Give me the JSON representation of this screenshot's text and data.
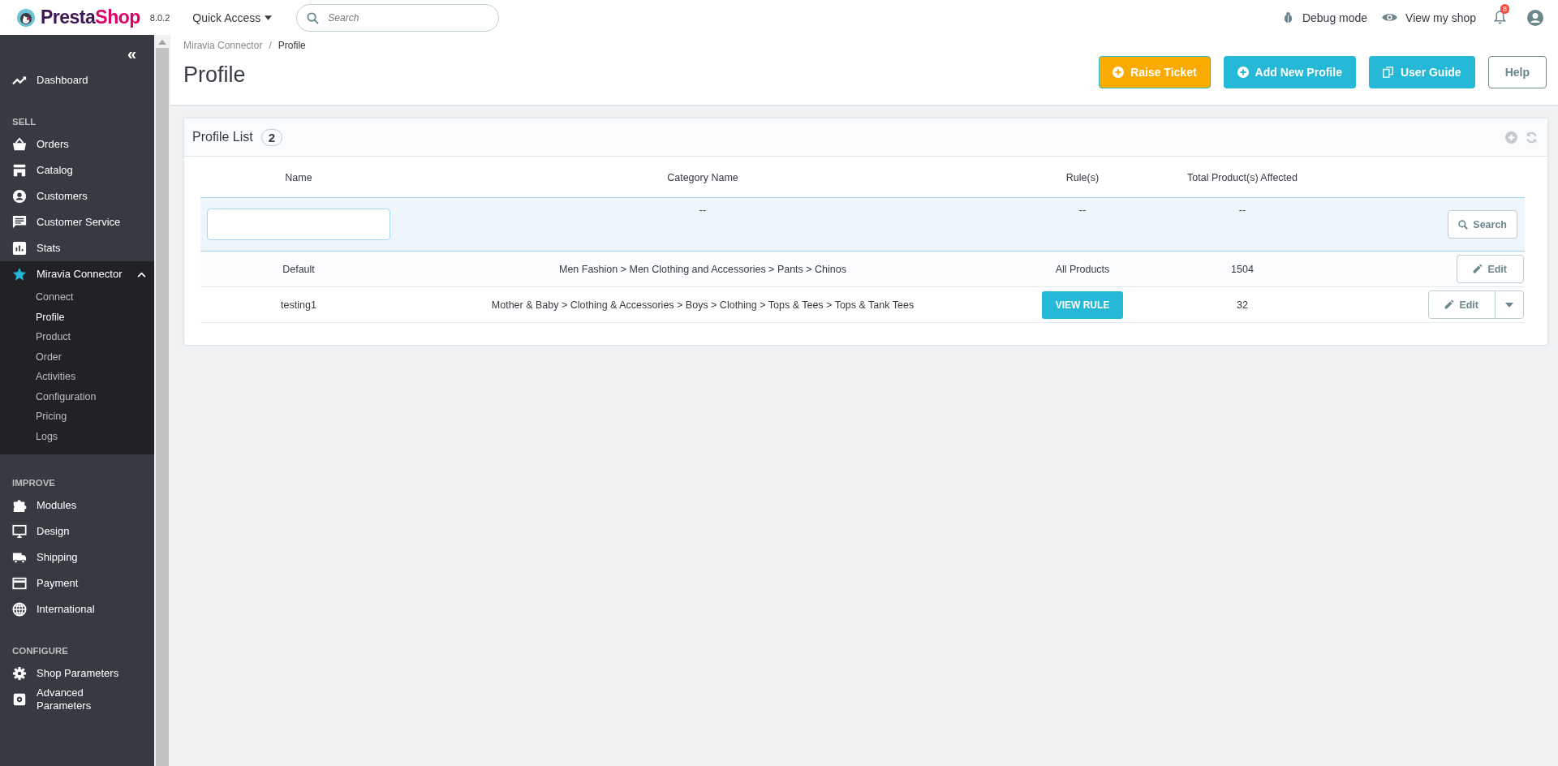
{
  "top_bar": {
    "brand": {
      "name_start": "Presta",
      "name_end": "Shop",
      "version": "8.0.2"
    },
    "quick_access": "Quick Access",
    "search": {
      "placeholder": "Search"
    },
    "debug_mode": "Debug mode",
    "view_shop": "View my shop",
    "notification_count": "8"
  },
  "sidebar": {
    "collapse": "«",
    "sections": [
      {
        "items": [
          {
            "label": "Dashboard",
            "expanded": false
          }
        ]
      },
      {
        "heading": "SELL",
        "items": [
          {
            "label": "Orders",
            "expanded": false
          },
          {
            "label": "Catalog",
            "expanded": false
          },
          {
            "label": "Customers",
            "expanded": false
          },
          {
            "label": "Customer Service",
            "expanded": false
          },
          {
            "label": "Stats",
            "expanded": false
          },
          {
            "label": "Miravia Connector",
            "expanded": true,
            "children": [
              {
                "label": "Connect",
                "selected": false
              },
              {
                "label": "Profile",
                "selected": true
              },
              {
                "label": "Product",
                "selected": false
              },
              {
                "label": "Order",
                "selected": false
              },
              {
                "label": "Activities",
                "selected": false
              },
              {
                "label": "Configuration",
                "selected": false
              },
              {
                "label": "Pricing",
                "selected": false
              },
              {
                "label": "Logs",
                "selected": false
              }
            ]
          }
        ]
      },
      {
        "heading": "IMPROVE",
        "items": [
          {
            "label": "Modules",
            "expanded": false
          },
          {
            "label": "Design",
            "expanded": false
          },
          {
            "label": "Shipping",
            "expanded": false
          },
          {
            "label": "Payment",
            "expanded": false
          },
          {
            "label": "International",
            "expanded": false
          }
        ]
      },
      {
        "heading": "CONFIGURE",
        "items": [
          {
            "label": "Shop Parameters",
            "expanded": false
          },
          {
            "label": "Advanced Parameters",
            "expanded": false
          }
        ]
      }
    ]
  },
  "breadcrumb": {
    "items": [
      "Miravia Connector",
      "Profile"
    ],
    "separator": "/"
  },
  "page_title": "Profile",
  "header_buttons": [
    {
      "label": "Raise Ticket"
    },
    {
      "label": "Add New Profile"
    },
    {
      "label": "User Guide"
    },
    {
      "label": "Help"
    }
  ],
  "panel": {
    "title": "Profile List",
    "count": "2",
    "table": {
      "columns": [
        "Name",
        "Category Name",
        "Rule(s)",
        "Total Product(s) Affected"
      ],
      "filter": {
        "category": "--",
        "rules": "--",
        "total": "--",
        "search_button": "Search"
      },
      "rows": [
        {
          "name": "Default",
          "category": "Men Fashion > Men Clothing and Accessories > Pants > Chinos",
          "rule": {
            "kind": "text",
            "text": "All Products"
          },
          "total": "1504",
          "action": "Edit",
          "has_dropdown": false
        },
        {
          "name": "testing1",
          "category": "Mother & Baby > Clothing & Accessories > Boys > Clothing > Tops & Tees > Tops & Tank Tees",
          "rule": {
            "kind": "button",
            "text": "VIEW RULE"
          },
          "total": "32",
          "action": "Edit",
          "has_dropdown": true
        }
      ]
    }
  }
}
